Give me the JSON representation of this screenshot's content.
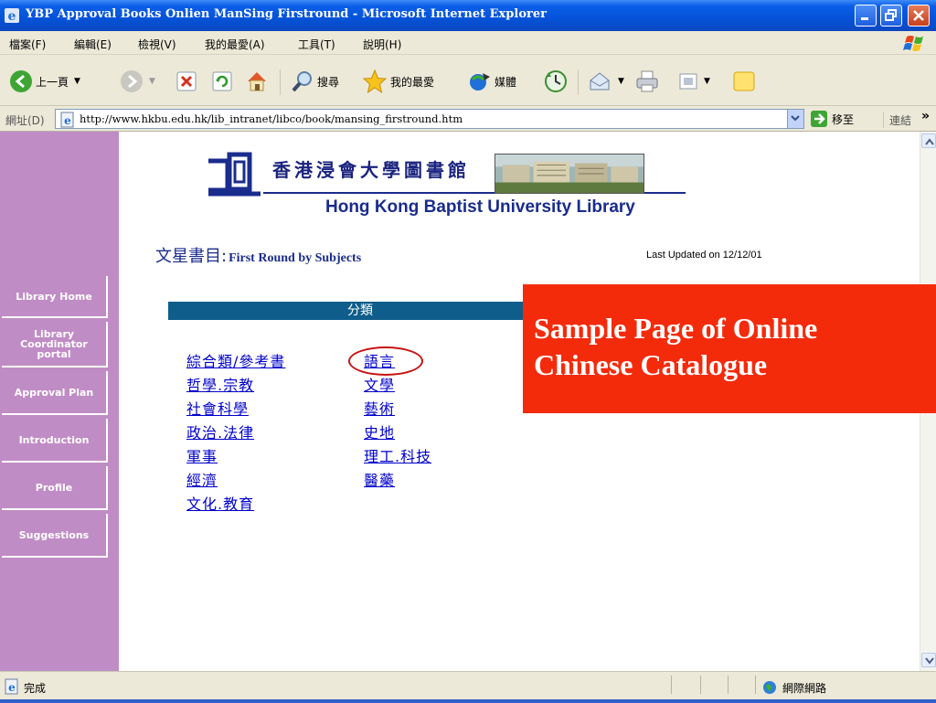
{
  "window": {
    "title": "YBP Approval Books Onlien ManSing Firstround - Microsoft Internet Explorer"
  },
  "menubar": {
    "items": [
      "檔案(F)",
      "編輯(E)",
      "檢視(V)",
      "我的最愛(A)",
      "工具(T)",
      "說明(H)"
    ]
  },
  "toolbar": {
    "back_label": "上一頁",
    "search_label": "搜尋",
    "favorites_label": "我的最愛",
    "media_label": "媒體"
  },
  "addressbar": {
    "label": "網址(D)",
    "url": "http://www.hkbu.edu.hk/lib_intranet/libco/book/mansing_firstround.htm",
    "go_label": "移至",
    "links_label": "連結",
    "links_chevron": "»"
  },
  "sidebar": {
    "items": [
      "Library Home",
      "Library Coordinator portal",
      "Approval Plan",
      "Introduction",
      "Profile",
      "Suggestions"
    ]
  },
  "page": {
    "logo_zh": "香港浸會大學圖書館",
    "logo_en": "Hong Kong Baptist University Library",
    "heading_zh": "文星書目:",
    "heading_en": "First Round by Subjects",
    "last_updated": "Last Updated on 12/12/01",
    "category_header": "分類",
    "categories_left": [
      "綜合類/參考書",
      "哲學.宗教",
      "社會科學",
      "政治.法律",
      "軍事",
      "經濟",
      "文化.教育"
    ],
    "categories_right": [
      "語言",
      "文學",
      "藝術",
      "史地",
      "理工.科技",
      "醫藥"
    ]
  },
  "callout": {
    "line1": "Sample Page of Online",
    "line2": "Chinese Catalogue"
  },
  "statusbar": {
    "status": "完成",
    "zone": "網際網路"
  },
  "colors": {
    "sidebar": "#c08cc5",
    "category_header": "#0f5d8a",
    "callout": "#f42b0b",
    "link": "#0000cc",
    "highlight_ring": "#c81414"
  }
}
